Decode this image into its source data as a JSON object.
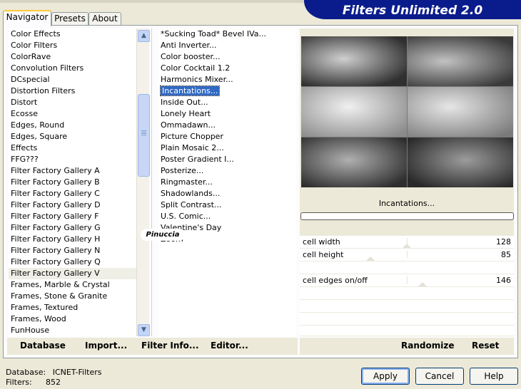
{
  "tabs": [
    {
      "label": "Navigator",
      "active": true
    },
    {
      "label": "Presets",
      "active": false
    },
    {
      "label": "About",
      "active": false
    }
  ],
  "banner": "Filters Unlimited 2.0",
  "categories": [
    "Color Effects",
    "Color Filters",
    "ColorRave",
    "Convolution Filters",
    "DCspecial",
    "Distortion Filters",
    "Distort",
    "Ecosse",
    "Edges, Round",
    "Edges, Square",
    "Effects",
    "FFG???",
    "Filter Factory Gallery A",
    "Filter Factory Gallery B",
    "Filter Factory Gallery C",
    "Filter Factory Gallery D",
    "Filter Factory Gallery F",
    "Filter Factory Gallery G",
    "Filter Factory Gallery H",
    "Filter Factory Gallery N",
    "Filter Factory Gallery Q",
    "Filter Factory Gallery V",
    "Frames, Marble & Crystal",
    "Frames, Stone & Granite",
    "Frames, Textured",
    "Frames, Wood",
    "FunHouse"
  ],
  "selected_category": "Filter Factory Gallery V",
  "filters": [
    "*Sucking Toad*  Bevel IVa...",
    "Anti Inverter...",
    "Color booster...",
    "Color Cocktail 1.2",
    "Harmonics Mixer...",
    "Incantations...",
    "Inside Out...",
    "Lonely Heart",
    "Ommadawn...",
    "Picture Chopper",
    "Plain Mosaic 2...",
    "Poster Gradient I...",
    "Posterize...",
    "Ringmaster...",
    "Shadowlands...",
    "Split Contrast...",
    "U.S. Comic...",
    "Valentine's Day",
    "Zoom"
  ],
  "selected_filter": "Incantations...",
  "preview_label": "Incantations...",
  "controls": [
    {
      "label": "cell width",
      "value": "128"
    },
    {
      "label": "cell height",
      "value": "85"
    },
    {
      "label": "",
      "value": ""
    },
    {
      "label": "cell edges on/off",
      "value": "146"
    }
  ],
  "bottom_buttons": {
    "database": "Database",
    "import": "Import...",
    "filter_info": "Filter Info...",
    "editor": "Editor...",
    "randomize": "Randomize",
    "reset": "Reset"
  },
  "status": {
    "database_label": "Database:",
    "database_value": "ICNET-Filters",
    "filters_label": "Filters:",
    "filters_value": "852"
  },
  "dialog_buttons": {
    "apply": "Apply",
    "cancel": "Cancel",
    "help": "Help"
  },
  "watermark": "Pinuccia"
}
